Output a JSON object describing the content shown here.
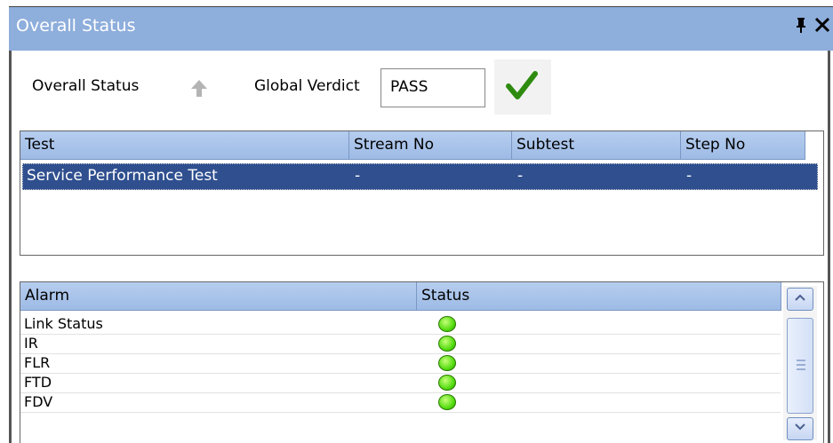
{
  "window": {
    "title": "Overall Status",
    "pin_icon": "pin-icon",
    "close_icon": "close-icon"
  },
  "status_bar": {
    "overall_label": "Overall Status",
    "overall_icon": "arrow-up-icon",
    "verdict_label": "Global Verdict",
    "verdict_value": "PASS",
    "verdict_icon": "checkmark-icon"
  },
  "test_table": {
    "columns": [
      "Test",
      "Stream No",
      "Subtest",
      "Step No"
    ],
    "rows": [
      {
        "test": "Service Performance Test",
        "stream": "-",
        "subtest": "-",
        "step": "-"
      }
    ]
  },
  "alarm_table": {
    "columns": [
      "Alarm",
      "Status"
    ],
    "rows": [
      {
        "alarm": "Link Status",
        "status": "green"
      },
      {
        "alarm": "IR",
        "status": "green"
      },
      {
        "alarm": "FLR",
        "status": "green"
      },
      {
        "alarm": "FTD",
        "status": "green"
      },
      {
        "alarm": "FDV",
        "status": "green"
      }
    ]
  },
  "colors": {
    "titlebar": "#8eaedc",
    "selection": "#2f4f8f",
    "status_ok": "#55dd11",
    "check": "#2e8b0f"
  }
}
